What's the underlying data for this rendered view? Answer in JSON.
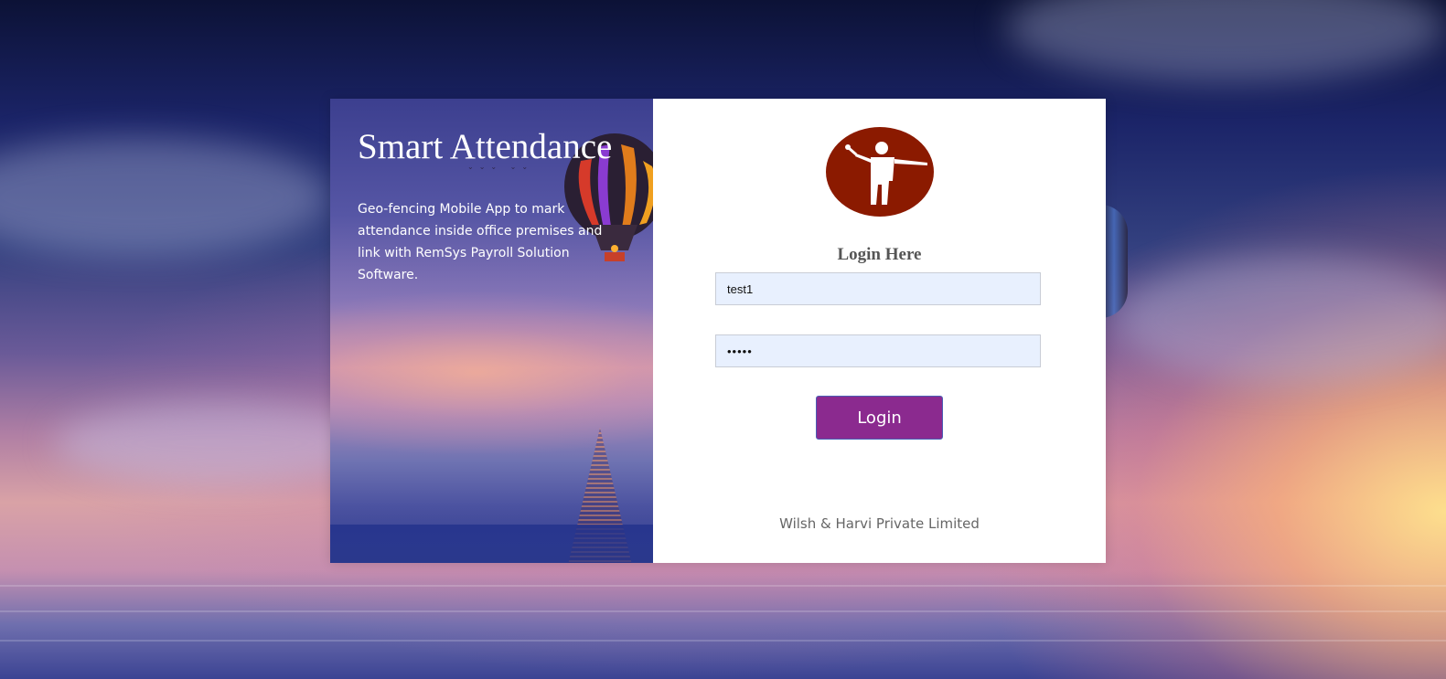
{
  "branding": {
    "app_title": "Smart Attendance",
    "description": "Geo-fencing Mobile App to mark attendance inside office premises and link with RemSys Payroll Solution Software.",
    "logo_icon": "person-with-stick-logo-icon",
    "logo_color": "#8b1a00"
  },
  "login": {
    "heading": "Login Here",
    "username_value": "test1",
    "password_value": "•••••",
    "button_label": "Login",
    "button_color": "#8b2a8f"
  },
  "footer": {
    "company": "Wilsh & Harvi Private Limited"
  }
}
